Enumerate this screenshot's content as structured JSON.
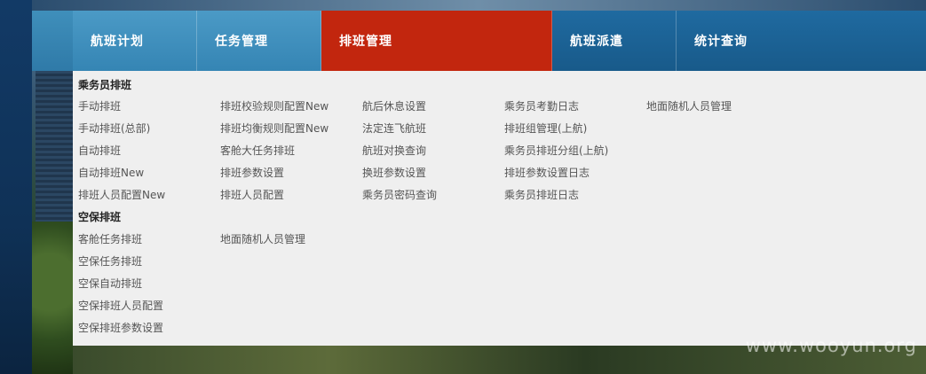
{
  "nav": {
    "tabs": [
      {
        "label": "航班计划"
      },
      {
        "label": "任务管理"
      },
      {
        "label": "排班管理"
      },
      {
        "label": "航班派遣"
      },
      {
        "label": "统计查询"
      }
    ],
    "active_color": "#c2260e"
  },
  "dropdown": {
    "sections": [
      {
        "title": "乘务员排班",
        "columns": [
          [
            "手动排班",
            "手动排班(总部)",
            "自动排班",
            "自动排班New",
            "排班人员配置New"
          ],
          [
            "排班校验规则配置New",
            "排班均衡规则配置New",
            "客舱大任务排班",
            "排班参数设置",
            "排班人员配置"
          ],
          [
            "航后休息设置",
            "法定连飞航班",
            "航班对换查询",
            "换班参数设置",
            "乘务员密码查询"
          ],
          [
            "乘务员考勤日志",
            "排班组管理(上航)",
            "乘务员排班分组(上航)",
            "排班参数设置日志",
            "乘务员排班日志"
          ],
          [
            "地面随机人员管理"
          ]
        ]
      },
      {
        "title": "空保排班",
        "columns": [
          [
            "客舱任务排班",
            "空保任务排班",
            "空保自动排班",
            "空保排班人员配置",
            "空保排班参数设置"
          ],
          [
            "地面随机人员管理"
          ]
        ]
      }
    ]
  },
  "watermark": "www.wooyun.org"
}
